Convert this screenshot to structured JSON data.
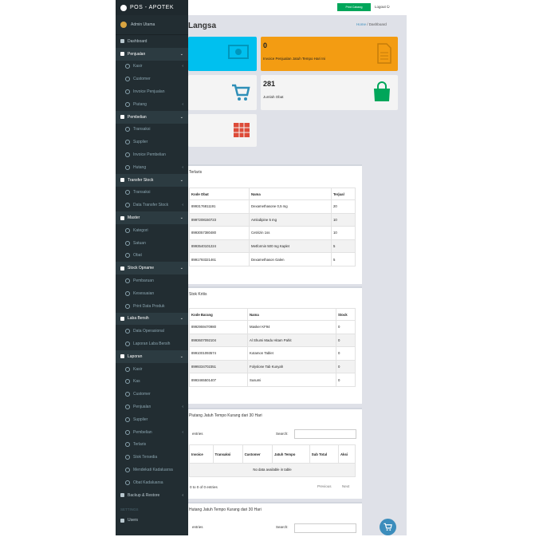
{
  "app": {
    "brand": "POS - APOTEK",
    "user": "Admin Utama"
  },
  "topbar": {
    "primary_button": "Print Cabang",
    "logout": "Logout ⏻"
  },
  "page": {
    "title": "Langsa",
    "breadcrumb_home": "Home",
    "breadcrumb_sep": " / ",
    "breadcrumb_current": "Dashboard"
  },
  "sidebar": {
    "items": [
      {
        "label": "Dashboard",
        "type": "main"
      },
      {
        "label": "Penjualan",
        "type": "head",
        "chev": "⌄"
      },
      {
        "label": "Kasir",
        "type": "sub",
        "chev": "‹"
      },
      {
        "label": "Customer",
        "type": "sub"
      },
      {
        "label": "Invoice Penjualan",
        "type": "sub"
      },
      {
        "label": "Piutang",
        "type": "sub",
        "chev": "‹"
      },
      {
        "label": "Pembelian",
        "type": "head",
        "chev": "⌄"
      },
      {
        "label": "Transaksi",
        "type": "sub"
      },
      {
        "label": "Supplier",
        "type": "sub"
      },
      {
        "label": "Invoice Pembelian",
        "type": "sub"
      },
      {
        "label": "Hutang",
        "type": "sub",
        "chev": "‹"
      },
      {
        "label": "Transfer Stock",
        "type": "head",
        "chev": "⌄"
      },
      {
        "label": "Transaksi",
        "type": "sub"
      },
      {
        "label": "Data Transfer Stock",
        "type": "sub",
        "chev": "‹"
      },
      {
        "label": "Master",
        "type": "head",
        "chev": "⌄"
      },
      {
        "label": "Kategori",
        "type": "sub"
      },
      {
        "label": "Satuan",
        "type": "sub"
      },
      {
        "label": "Obat",
        "type": "sub"
      },
      {
        "label": "Stock Opname",
        "type": "head",
        "chev": "⌄"
      },
      {
        "label": "Pembaruan",
        "type": "sub"
      },
      {
        "label": "Kesesuaian",
        "type": "sub"
      },
      {
        "label": "Print Data Produk",
        "type": "sub"
      },
      {
        "label": "Laba Bersih",
        "type": "head",
        "chev": "⌄"
      },
      {
        "label": "Data Operasional",
        "type": "sub"
      },
      {
        "label": "Laporan Laba Bersih",
        "type": "sub"
      },
      {
        "label": "Laporan",
        "type": "head",
        "chev": "⌄"
      },
      {
        "label": "Kasir",
        "type": "sub"
      },
      {
        "label": "Kas",
        "type": "sub"
      },
      {
        "label": "Customer",
        "type": "sub"
      },
      {
        "label": "Penjualan",
        "type": "sub",
        "chev": "‹"
      },
      {
        "label": "Supplier",
        "type": "sub"
      },
      {
        "label": "Pembelian",
        "type": "sub",
        "chev": "‹"
      },
      {
        "label": "Terlaris",
        "type": "sub"
      },
      {
        "label": "Stok Tersedia",
        "type": "sub"
      },
      {
        "label": "Mendekati Kadaluarsa",
        "type": "sub"
      },
      {
        "label": "Obat Kadaluarsa",
        "type": "sub"
      },
      {
        "label": "Backup & Restore",
        "type": "main",
        "chev": "‹"
      }
    ],
    "settings_label": "SETTINGS",
    "users_label": "Users"
  },
  "tiles": {
    "yellow_num": "0",
    "yellow_caption": "Invoice Penjualan Jatuh Tempo Hari Ini",
    "obat_num": "281",
    "obat_caption": "Jumlah Obat"
  },
  "tables": {
    "terlaris": {
      "title": "Terlaris",
      "headers": [
        "Kode Obat",
        "Nama",
        "Terjual"
      ],
      "rows": [
        [
          "8993176811191",
          "Dexamethasone 0,5 mg",
          "20"
        ],
        [
          "8997208150723",
          "Amlodipine 5 mg",
          "10"
        ],
        [
          "8993057380480",
          "Cetirizin 1ss",
          "10"
        ],
        [
          "8993540101224",
          "Metformin 500 mg Kaplet",
          "5"
        ],
        [
          "8991793321461",
          "Dexamethason Galen",
          "5"
        ]
      ]
    },
    "stok": {
      "title": "Stok Kritis",
      "headers": [
        "Kode Barang",
        "Nama",
        "Stock"
      ],
      "rows": [
        [
          "8992959470980",
          "Masker KF94",
          "0"
        ],
        [
          "8993607092104",
          "Al Shumi Madu Hitam Pahit",
          "0"
        ],
        [
          "8991001093574",
          "Kotamon Tablet",
          "0"
        ],
        [
          "8999334702351",
          "Folyslone Tab Kunyah",
          "0"
        ],
        [
          "8993465501407",
          "Susumi",
          "0"
        ]
      ]
    },
    "piutang": {
      "title": "Piutang Jatuh Tempo Kurang dari 30 Hari",
      "entries": "entries",
      "search": "Search:",
      "headers": [
        "Invoice",
        "Transaksi",
        "Customer",
        "Jatuh Tempo",
        "Sub Total",
        "Aksi"
      ],
      "empty": "No data available in table",
      "info": "0 to 0 of 0 entries",
      "prev": "Previous",
      "next": "Next"
    },
    "hutang": {
      "title": "Hutang Jatuh Tempo Kurang dari 30 Hari",
      "entries": "entries",
      "search": "Search:"
    }
  },
  "colors": {
    "aqua": "#00c0ef",
    "yellow": "#f39c12",
    "green": "#00a65a",
    "red": "#dd4b39"
  }
}
